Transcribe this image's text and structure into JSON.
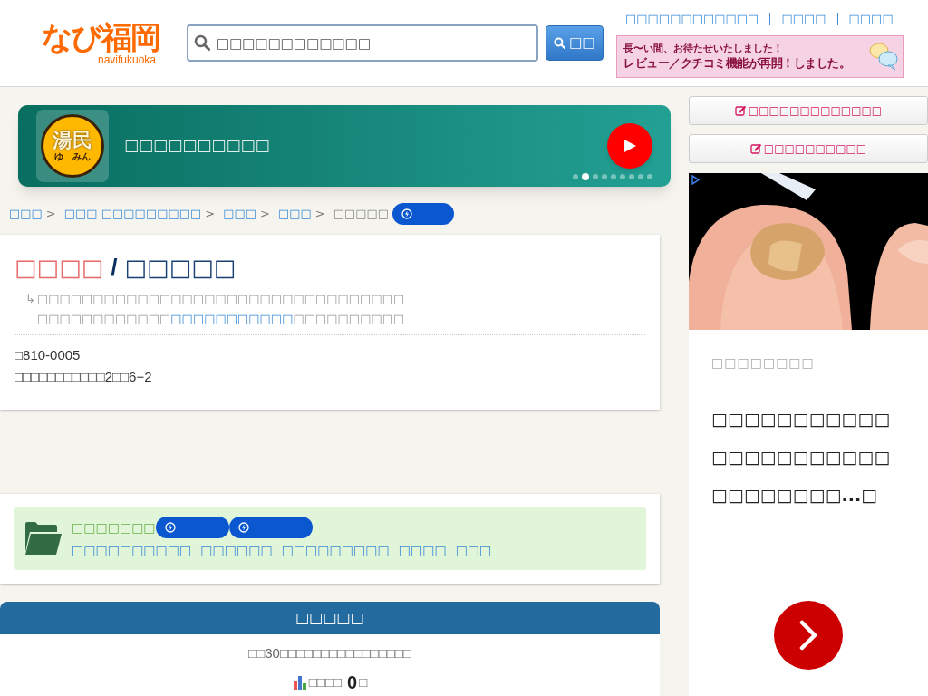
{
  "header": {
    "logo": "なび福岡",
    "logo_sub": "navifukuoka",
    "search": {
      "placeholder": "□□□□□□□□□□□□",
      "button": "□□"
    },
    "links": [
      "□□□□□□□□□□□□",
      "□□□□",
      "□□□□"
    ],
    "notice": {
      "line1": "長〜い間、お待たせいたしました！",
      "line2": "レビュー／クチコミ機能が再開！しました。"
    }
  },
  "hero": {
    "badge": "湯民",
    "badge_sub1": "ゆ",
    "badge_sub2": "みん",
    "title": "□□□□□□□□□□",
    "slides": [
      {
        "selected": false
      },
      {
        "selected": true
      },
      {
        "selected": false
      },
      {
        "selected": false
      },
      {
        "selected": false
      },
      {
        "selected": false
      },
      {
        "selected": false
      },
      {
        "selected": false
      },
      {
        "selected": false
      }
    ]
  },
  "breadcrumb": {
    "separator": ">",
    "links": [
      "□□□",
      "□□□ □□□□□□□□□",
      "□□□",
      "□□□"
    ],
    "current": "□□□□□"
  },
  "place": {
    "name": "□□□□",
    "name_sub": "□□□□□",
    "separator": "/",
    "arrow": "↳",
    "note_1": "□□□□□□□□□□□□□□□□□□□□□□□□□□□□□□□□□□□□□□",
    "note_2": "□□□□□□□",
    "note_link": "□□□□□□□□□□□",
    "note_3": "□□□□□□□□□□",
    "postal": "□810-0005",
    "address": "□□□□□□□□□□□2□□6−2"
  },
  "category": {
    "label": "□□□□□□□",
    "pills": [
      {
        "kind": "lightning"
      },
      {
        "kind": "lightning"
      }
    ],
    "links": [
      "□□□□□□□□□□",
      "□□□□□□",
      "□□□□□□□□□",
      "□□□□",
      "□□□"
    ]
  },
  "ranking": {
    "title": "□□□□□",
    "subtitle": "□□30□□□□□□□□□□□□□□□□",
    "count_label": "□□□□",
    "count": "0",
    "count_unit": "□"
  },
  "sidebar": {
    "buttons": [
      "□□□□□□□□□□□□□",
      "□□□□□□□□□□"
    ]
  },
  "ad": {
    "kicker": "□□□□□□□□",
    "headline": "□□□□□□□□□□□□□□□□□□□□□□□□□□□□□□...□"
  }
}
